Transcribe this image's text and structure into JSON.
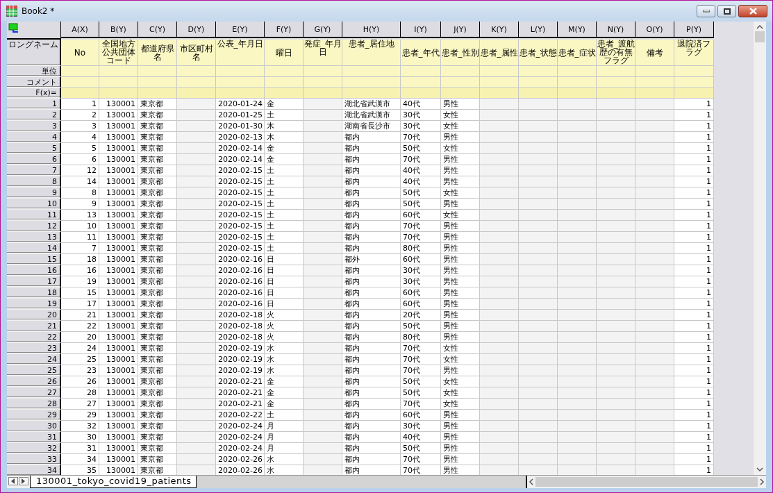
{
  "window": {
    "title": "Book2 *"
  },
  "row_labels": {
    "long_name": "ロングネーム",
    "units": "単位",
    "comment": "コメント",
    "formula": "F(x)="
  },
  "columns": [
    {
      "name": "A(X)",
      "long_name": "No",
      "kind": "number"
    },
    {
      "name": "B(Y)",
      "long_name": "全国地方公共団体コード",
      "kind": "number"
    },
    {
      "name": "C(Y)",
      "long_name": "都道府県名",
      "kind": "text"
    },
    {
      "name": "D(Y)",
      "long_name": "市区町村名",
      "kind": "empty"
    },
    {
      "name": "E(Y)",
      "long_name": "公表_年月日",
      "kind": "date"
    },
    {
      "name": "F(Y)",
      "long_name": "曜日",
      "kind": "text"
    },
    {
      "name": "G(Y)",
      "long_name": "発症_年月日",
      "kind": "empty"
    },
    {
      "name": "H(Y)",
      "long_name": "患者_居住地",
      "kind": "text"
    },
    {
      "name": "I(Y)",
      "long_name": "患者_年代",
      "kind": "text"
    },
    {
      "name": "J(Y)",
      "long_name": "患者_性別",
      "kind": "text"
    },
    {
      "name": "K(Y)",
      "long_name": "患者_属性",
      "kind": "empty"
    },
    {
      "name": "L(Y)",
      "long_name": "患者_状態",
      "kind": "empty"
    },
    {
      "name": "M(Y)",
      "long_name": "患者_症状",
      "kind": "empty"
    },
    {
      "name": "N(Y)",
      "long_name": "患者_渡航歴の有無フラグ",
      "kind": "empty"
    },
    {
      "name": "O(Y)",
      "long_name": "備考",
      "kind": "empty"
    },
    {
      "name": "P(Y)",
      "long_name": "退院済フラグ",
      "kind": "number"
    }
  ],
  "rows": [
    {
      "label": "1",
      "values": [
        "1",
        "130001",
        "東京都",
        "2020-01-24",
        "金",
        "湖北省武漢市",
        "40代",
        "男性",
        "1"
      ]
    },
    {
      "label": "2",
      "values": [
        "2",
        "130001",
        "東京都",
        "2020-01-25",
        "土",
        "湖北省武漢市",
        "30代",
        "女性",
        "1"
      ]
    },
    {
      "label": "3",
      "values": [
        "3",
        "130001",
        "東京都",
        "2020-01-30",
        "木",
        "湖南省長沙市",
        "30代",
        "女性",
        "1"
      ]
    },
    {
      "label": "4",
      "values": [
        "4",
        "130001",
        "東京都",
        "2020-02-13",
        "木",
        "都内",
        "70代",
        "男性",
        "1"
      ]
    },
    {
      "label": "5",
      "values": [
        "5",
        "130001",
        "東京都",
        "2020-02-14",
        "金",
        "都内",
        "50代",
        "女性",
        "1"
      ]
    },
    {
      "label": "6",
      "values": [
        "6",
        "130001",
        "東京都",
        "2020-02-14",
        "金",
        "都内",
        "70代",
        "男性",
        "1"
      ]
    },
    {
      "label": "7",
      "values": [
        "12",
        "130001",
        "東京都",
        "2020-02-15",
        "土",
        "都内",
        "40代",
        "男性",
        "1"
      ]
    },
    {
      "label": "8",
      "values": [
        "14",
        "130001",
        "東京都",
        "2020-02-15",
        "土",
        "都内",
        "40代",
        "男性",
        "1"
      ]
    },
    {
      "label": "9",
      "values": [
        "8",
        "130001",
        "東京都",
        "2020-02-15",
        "土",
        "都内",
        "50代",
        "女性",
        "1"
      ]
    },
    {
      "label": "10",
      "values": [
        "9",
        "130001",
        "東京都",
        "2020-02-15",
        "土",
        "都内",
        "50代",
        "男性",
        "1"
      ]
    },
    {
      "label": "11",
      "values": [
        "13",
        "130001",
        "東京都",
        "2020-02-15",
        "土",
        "都内",
        "60代",
        "女性",
        "1"
      ]
    },
    {
      "label": "12",
      "values": [
        "10",
        "130001",
        "東京都",
        "2020-02-15",
        "土",
        "都内",
        "70代",
        "男性",
        "1"
      ]
    },
    {
      "label": "13",
      "values": [
        "11",
        "130001",
        "東京都",
        "2020-02-15",
        "土",
        "都内",
        "70代",
        "男性",
        "1"
      ]
    },
    {
      "label": "14",
      "values": [
        "7",
        "130001",
        "東京都",
        "2020-02-15",
        "土",
        "都内",
        "80代",
        "男性",
        "1"
      ]
    },
    {
      "label": "15",
      "values": [
        "18",
        "130001",
        "東京都",
        "2020-02-16",
        "日",
        "都外",
        "60代",
        "男性",
        "1"
      ]
    },
    {
      "label": "16",
      "values": [
        "16",
        "130001",
        "東京都",
        "2020-02-16",
        "日",
        "都内",
        "30代",
        "男性",
        "1"
      ]
    },
    {
      "label": "17",
      "values": [
        "19",
        "130001",
        "東京都",
        "2020-02-16",
        "日",
        "都内",
        "30代",
        "男性",
        "1"
      ]
    },
    {
      "label": "18",
      "values": [
        "15",
        "130001",
        "東京都",
        "2020-02-16",
        "日",
        "都内",
        "60代",
        "男性",
        "1"
      ]
    },
    {
      "label": "19",
      "values": [
        "17",
        "130001",
        "東京都",
        "2020-02-16",
        "日",
        "都内",
        "60代",
        "男性",
        "1"
      ]
    },
    {
      "label": "20",
      "values": [
        "21",
        "130001",
        "東京都",
        "2020-02-18",
        "火",
        "都内",
        "20代",
        "男性",
        "1"
      ]
    },
    {
      "label": "21",
      "values": [
        "22",
        "130001",
        "東京都",
        "2020-02-18",
        "火",
        "都内",
        "50代",
        "男性",
        "1"
      ]
    },
    {
      "label": "22",
      "values": [
        "20",
        "130001",
        "東京都",
        "2020-02-18",
        "火",
        "都内",
        "80代",
        "男性",
        "1"
      ]
    },
    {
      "label": "23",
      "values": [
        "24",
        "130001",
        "東京都",
        "2020-02-19",
        "水",
        "都内",
        "70代",
        "女性",
        "1"
      ]
    },
    {
      "label": "24",
      "values": [
        "25",
        "130001",
        "東京都",
        "2020-02-19",
        "水",
        "都内",
        "70代",
        "女性",
        "1"
      ]
    },
    {
      "label": "25",
      "values": [
        "23",
        "130001",
        "東京都",
        "2020-02-19",
        "水",
        "都内",
        "70代",
        "男性",
        "1"
      ]
    },
    {
      "label": "26",
      "values": [
        "26",
        "130001",
        "東京都",
        "2020-02-21",
        "金",
        "都内",
        "50代",
        "女性",
        "1"
      ]
    },
    {
      "label": "27",
      "values": [
        "28",
        "130001",
        "東京都",
        "2020-02-21",
        "金",
        "都内",
        "50代",
        "女性",
        "1"
      ]
    },
    {
      "label": "28",
      "values": [
        "27",
        "130001",
        "東京都",
        "2020-02-21",
        "金",
        "都内",
        "70代",
        "女性",
        "1"
      ]
    },
    {
      "label": "29",
      "values": [
        "29",
        "130001",
        "東京都",
        "2020-02-22",
        "土",
        "都内",
        "60代",
        "男性",
        "1"
      ]
    },
    {
      "label": "30",
      "values": [
        "32",
        "130001",
        "東京都",
        "2020-02-24",
        "月",
        "都内",
        "30代",
        "男性",
        "1"
      ]
    },
    {
      "label": "31",
      "values": [
        "30",
        "130001",
        "東京都",
        "2020-02-24",
        "月",
        "都内",
        "40代",
        "男性",
        "1"
      ]
    },
    {
      "label": "32",
      "values": [
        "31",
        "130001",
        "東京都",
        "2020-02-24",
        "月",
        "都内",
        "50代",
        "男性",
        "1"
      ]
    },
    {
      "label": "33",
      "values": [
        "34",
        "130001",
        "東京都",
        "2020-02-26",
        "水",
        "都内",
        "70代",
        "男性",
        "1"
      ]
    },
    {
      "label": "34",
      "values": [
        "35",
        "130001",
        "東京都",
        "2020-02-26",
        "水",
        "都内",
        "70代",
        "男性",
        "1"
      ]
    }
  ],
  "sheet_tabs": [
    {
      "label": "130001_tokyo_covid19_patients",
      "selected": true
    }
  ]
}
